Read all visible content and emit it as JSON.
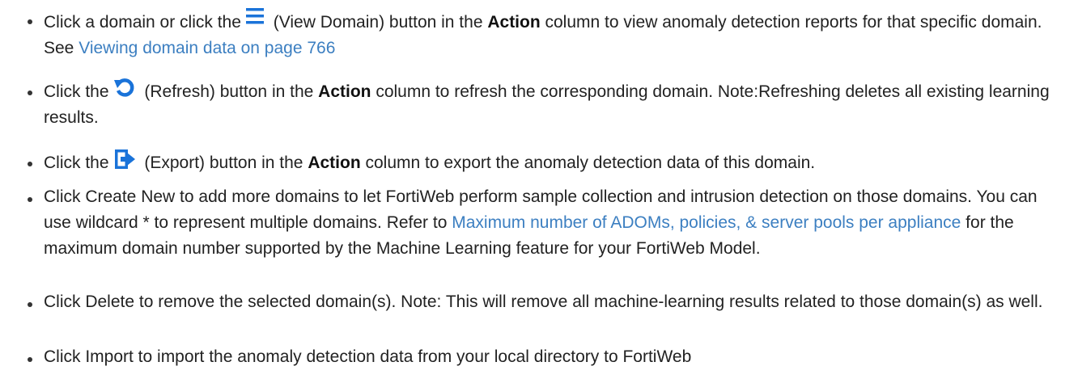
{
  "items": [
    {
      "pre": "Click a domain or click the",
      "icon": "view-domain-icon",
      "mid1": " (View Domain) button in the ",
      "bold": "Action",
      "mid2": " column to view anomaly detection reports for that specific domain. See ",
      "link": "Viewing domain data on page 766"
    },
    {
      "pre": "Click the",
      "icon": "refresh-icon",
      "mid1": " (Refresh) button in the ",
      "bold": "Action",
      "mid2": " column to refresh the corresponding domain. Note:Refreshing deletes all existing learning results."
    },
    {
      "pre": "Click the",
      "icon": "export-icon",
      "mid1": " (Export) button in the ",
      "bold": "Action",
      "mid2": " column to export the anomaly detection data of this domain."
    },
    {
      "pre": "Click Create New to add more domains to let FortiWeb perform sample collection and intrusion detection on those domains. You can use wildcard * to represent multiple domains. Refer to ",
      "link": "Maximum number of ADOMs, policies, & server pools per appliance",
      "post": " for the maximum domain number supported by the Machine Learning feature for your FortiWeb Model."
    },
    {
      "text": "Click Delete to remove the selected domain(s). Note: This will remove all machine-learning results related to those domain(s) as well."
    },
    {
      "text": "Click Import to import the anomaly detection data from your local directory to FortiWeb"
    }
  ],
  "colors": {
    "icon": "#1a73d9",
    "link": "#3c7fc1",
    "text": "#222222"
  }
}
